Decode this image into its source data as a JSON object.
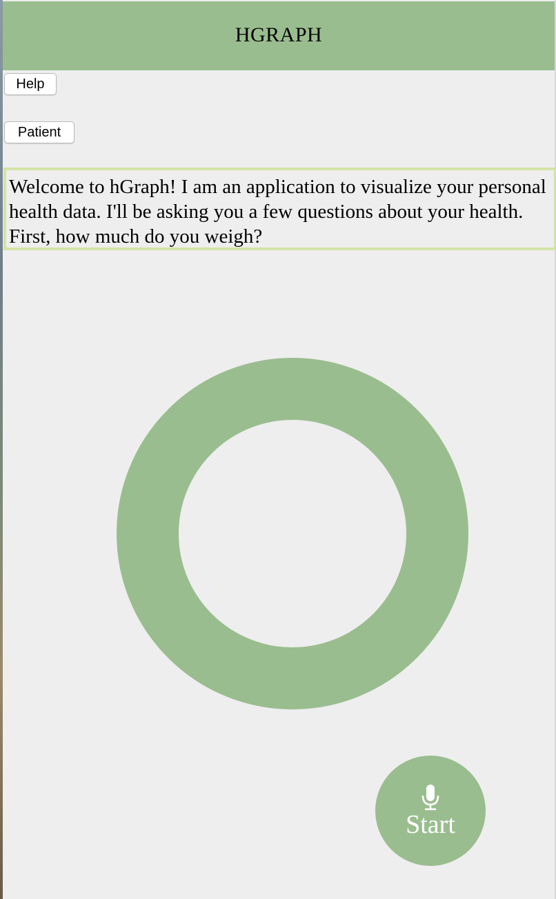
{
  "header": {
    "title": "HGRAPH"
  },
  "buttons": {
    "help_label": "Help",
    "patient_label": "Patient"
  },
  "message": {
    "text": "Welcome to hGraph! I am an application to visualize your personal health data. I'll be asking you a few questions about your health. First, how much do you weigh?"
  },
  "record": {
    "start_label": "Start",
    "icon": "microphone-icon"
  },
  "colors": {
    "accent": "#9abd8f",
    "message_border": "#d3e3a5",
    "background": "#eeeeee"
  }
}
